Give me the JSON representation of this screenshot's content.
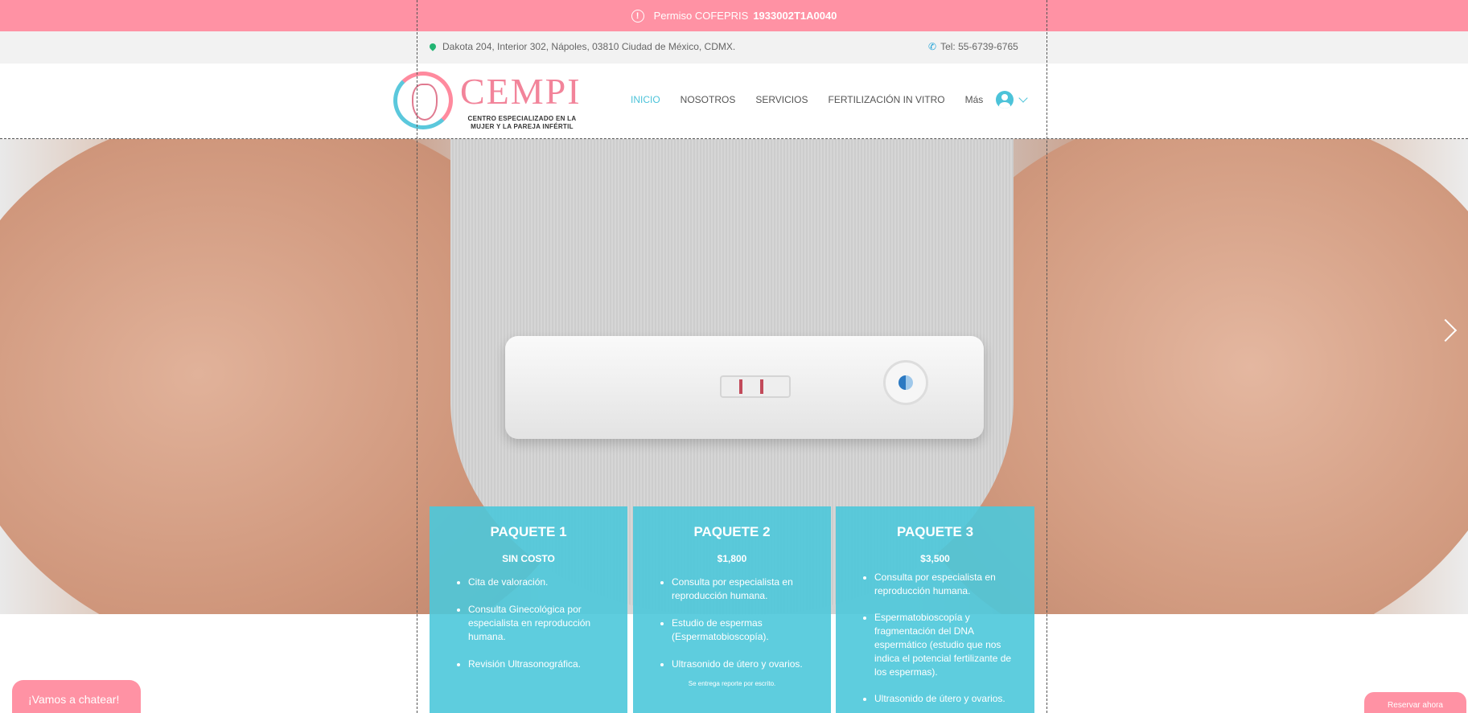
{
  "topbar": {
    "permit_label": "Permiso COFEPRIS",
    "permit_number": "1933002T1A0040",
    "icon": "warning-icon"
  },
  "infobar": {
    "address": "Dakota 204, Interior 302, Nápoles, 03810 Ciudad de México, CDMX.",
    "phone": "Tel: 55-6739-6765"
  },
  "logo": {
    "name": "CEMPI",
    "tagline_1": "CENTRO ESPECIALIZADO EN LA",
    "tagline_2": "MUJER Y LA PAREJA INFÉRTIL"
  },
  "nav": {
    "items": [
      "INICIO",
      "NOSOTROS",
      "SERVICIOS",
      "FERTILIZACIÓN IN VITRO",
      "Más"
    ],
    "active": "INICIO"
  },
  "packages": [
    {
      "title": "PAQUETE 1",
      "price": "SIN COSTO",
      "items": [
        "Cita de valoración.",
        "Consulta Ginecológica por especialista en reproducción humana.",
        "Revisión Ultrasonográfica."
      ],
      "note": ""
    },
    {
      "title": "PAQUETE 2",
      "price": "$1,800",
      "items": [
        "Consulta por especialista en reproducción humana.",
        "Estudio de espermas (Espermatobioscopía).",
        "Ultrasonido de útero y ovarios."
      ],
      "note": "Se entrega reporte por escrito."
    },
    {
      "title": "PAQUETE 3",
      "price": "$3,500",
      "items": [
        "Consulta por especialista en reproducción humana.",
        "Espermatobioscopía y fragmentación del DNA espermático (estudio que nos indica el potencial fertilizante de los espermas).",
        "Ultrasonido de útero y ovarios."
      ],
      "note": ""
    }
  ],
  "chat": {
    "label": "¡Vamos a chatear!"
  },
  "reserve": {
    "label": "Reservar ahora"
  },
  "colors": {
    "pink": "#ff92a4",
    "teal": "#4cc3d9",
    "card": "#4cc8da"
  }
}
